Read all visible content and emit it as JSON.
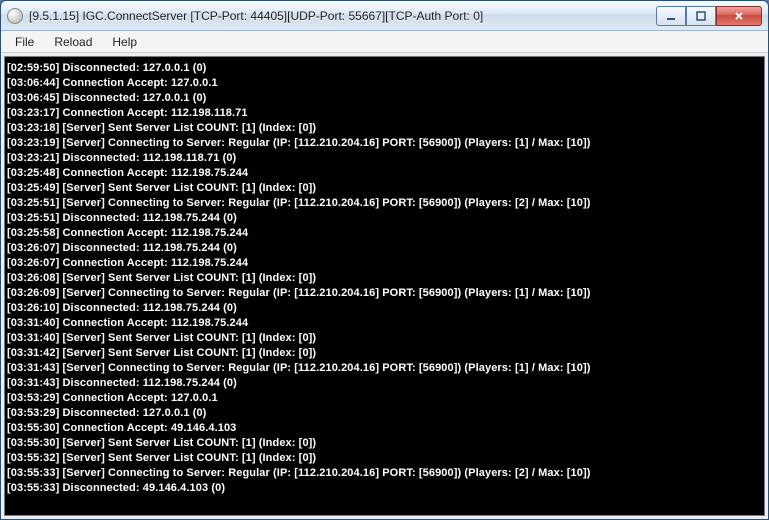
{
  "window": {
    "title": "[9.5.1.15] IGC.ConnectServer [TCP-Port: 44405][UDP-Port: 55667][TCP-Auth Port: 0]"
  },
  "menu": {
    "items": [
      "File",
      "Reload",
      "Help"
    ]
  },
  "icons": {
    "minimize": "minimize-icon",
    "maximize": "maximize-icon",
    "close": "close-icon"
  },
  "log": {
    "lines": [
      "[02:59:50] Disconnected: 127.0.0.1 (0)",
      "[03:06:44] Connection Accept: 127.0.0.1",
      "[03:06:45] Disconnected: 127.0.0.1 (0)",
      "[03:23:17] Connection Accept: 112.198.118.71",
      "[03:23:18] [Server] Sent Server List COUNT: [1] (Index: [0])",
      "[03:23:19] [Server] Connecting to Server: Regular (IP: [112.210.204.16] PORT: [56900]) (Players: [1] / Max: [10])",
      "[03:23:21] Disconnected: 112.198.118.71 (0)",
      "[03:25:48] Connection Accept: 112.198.75.244",
      "[03:25:49] [Server] Sent Server List COUNT: [1] (Index: [0])",
      "[03:25:51] [Server] Connecting to Server: Regular (IP: [112.210.204.16] PORT: [56900]) (Players: [2] / Max: [10])",
      "[03:25:51] Disconnected: 112.198.75.244 (0)",
      "[03:25:58] Connection Accept: 112.198.75.244",
      "[03:26:07] Disconnected: 112.198.75.244 (0)",
      "[03:26:07] Connection Accept: 112.198.75.244",
      "[03:26:08] [Server] Sent Server List COUNT: [1] (Index: [0])",
      "[03:26:09] [Server] Connecting to Server: Regular (IP: [112.210.204.16] PORT: [56900]) (Players: [1] / Max: [10])",
      "[03:26:10] Disconnected: 112.198.75.244 (0)",
      "[03:31:40] Connection Accept: 112.198.75.244",
      "[03:31:40] [Server] Sent Server List COUNT: [1] (Index: [0])",
      "[03:31:42] [Server] Sent Server List COUNT: [1] (Index: [0])",
      "[03:31:43] [Server] Connecting to Server: Regular (IP: [112.210.204.16] PORT: [56900]) (Players: [1] / Max: [10])",
      "[03:31:43] Disconnected: 112.198.75.244 (0)",
      "[03:53:29] Connection Accept: 127.0.0.1",
      "[03:53:29] Disconnected: 127.0.0.1 (0)",
      "[03:55:30] Connection Accept: 49.146.4.103",
      "[03:55:30] [Server] Sent Server List COUNT: [1] (Index: [0])",
      "[03:55:32] [Server] Sent Server List COUNT: [1] (Index: [0])",
      "[03:55:33] [Server] Connecting to Server: Regular (IP: [112.210.204.16] PORT: [56900]) (Players: [2] / Max: [10])",
      "[03:55:33] Disconnected: 49.146.4.103 (0)"
    ]
  }
}
